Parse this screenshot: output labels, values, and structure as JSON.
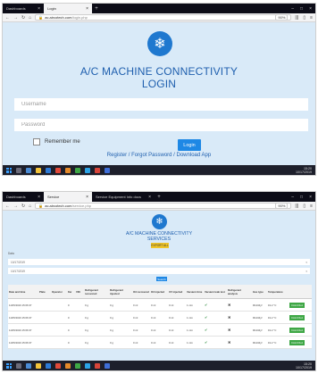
{
  "login_window": {
    "tabs": [
      {
        "label": "Dashboards",
        "active": false
      },
      {
        "label": "Login",
        "active": true
      }
    ],
    "url": {
      "domain": "ac.aircotech.com",
      "path": "/login.php"
    },
    "zoom": "90%",
    "title_line1": "A/C MACHINE CONNECTIVITY",
    "title_line2": "LOGIN",
    "username_placeholder": "Username",
    "password_placeholder": "Password",
    "remember_label": "Remember me",
    "login_button": "Login",
    "links": {
      "register": "Register",
      "sep1": " / ",
      "forgot": "Forgot Password",
      "sep2": " / ",
      "download": "Download App"
    },
    "clock": {
      "time": "15:20",
      "date": "10/17/2019"
    }
  },
  "data_window": {
    "tabs": [
      {
        "label": "Dashboards",
        "active": false
      },
      {
        "label": "Service",
        "active": true
      },
      {
        "label": "Service Equipment Info docs",
        "active": false
      }
    ],
    "url": {
      "domain": "ac.aircotech.com",
      "path": "/service.php"
    },
    "zoom": "90%",
    "title_line1": "A/C MACHINE CONNECTIVITY",
    "title_line2": "SERVICES",
    "export_button": "EXPORT ALL",
    "filter_label": "Data",
    "date_from": "10/17/2019",
    "date_to": "10/17/2019",
    "search_button": "Search",
    "table": {
      "headers": [
        "Date and time",
        "Plate",
        "Operator",
        "Kw",
        "VIN",
        "Refrigerant recovered",
        "Refrigerant injected",
        "Oil recovered",
        "Oil injected",
        "UV injected",
        "Vacuum time",
        "Vacuum leak test",
        "Refrigerant analysis",
        "Gas type",
        "Temperature",
        ""
      ],
      "rows": [
        [
          "11/05/2019 15:06:37",
          "",
          "",
          "0",
          "",
          "0 g",
          "0 g",
          "0 ml",
          "0 ml",
          "0 ml",
          "1 min",
          "✔",
          "✖",
          "R1234yf",
          "19.2 °C",
          "CALCOLA"
        ],
        [
          "11/05/2019 15:06:37",
          "",
          "",
          "0",
          "",
          "0 g",
          "0 g",
          "0 ml",
          "0 ml",
          "0 ml",
          "1 min",
          "✔",
          "✖",
          "R1234yf",
          "19.2 °C",
          "CALCOLA"
        ],
        [
          "11/05/2019 15:06:37",
          "",
          "",
          "0",
          "",
          "0 g",
          "0 g",
          "0 ml",
          "0 ml",
          "0 ml",
          "1 min",
          "✔",
          "✖",
          "R1234yf",
          "19.2 °C",
          "CALCOLA"
        ],
        [
          "11/05/2019 15:06:37",
          "",
          "",
          "0",
          "",
          "0 g",
          "0 g",
          "0 ml",
          "0 ml",
          "0 ml",
          "1 min",
          "✔",
          "✖",
          "R1234yf",
          "19.2 °C",
          "CALCOLA"
        ]
      ]
    },
    "clock": {
      "time": "15:20",
      "date": "10/17/2019"
    }
  },
  "colors": {
    "accent": "#1e88e5",
    "page_bg": "#d9eaf8",
    "title": "#1f5fae",
    "export": "#f0c528",
    "action": "#3ea745"
  }
}
